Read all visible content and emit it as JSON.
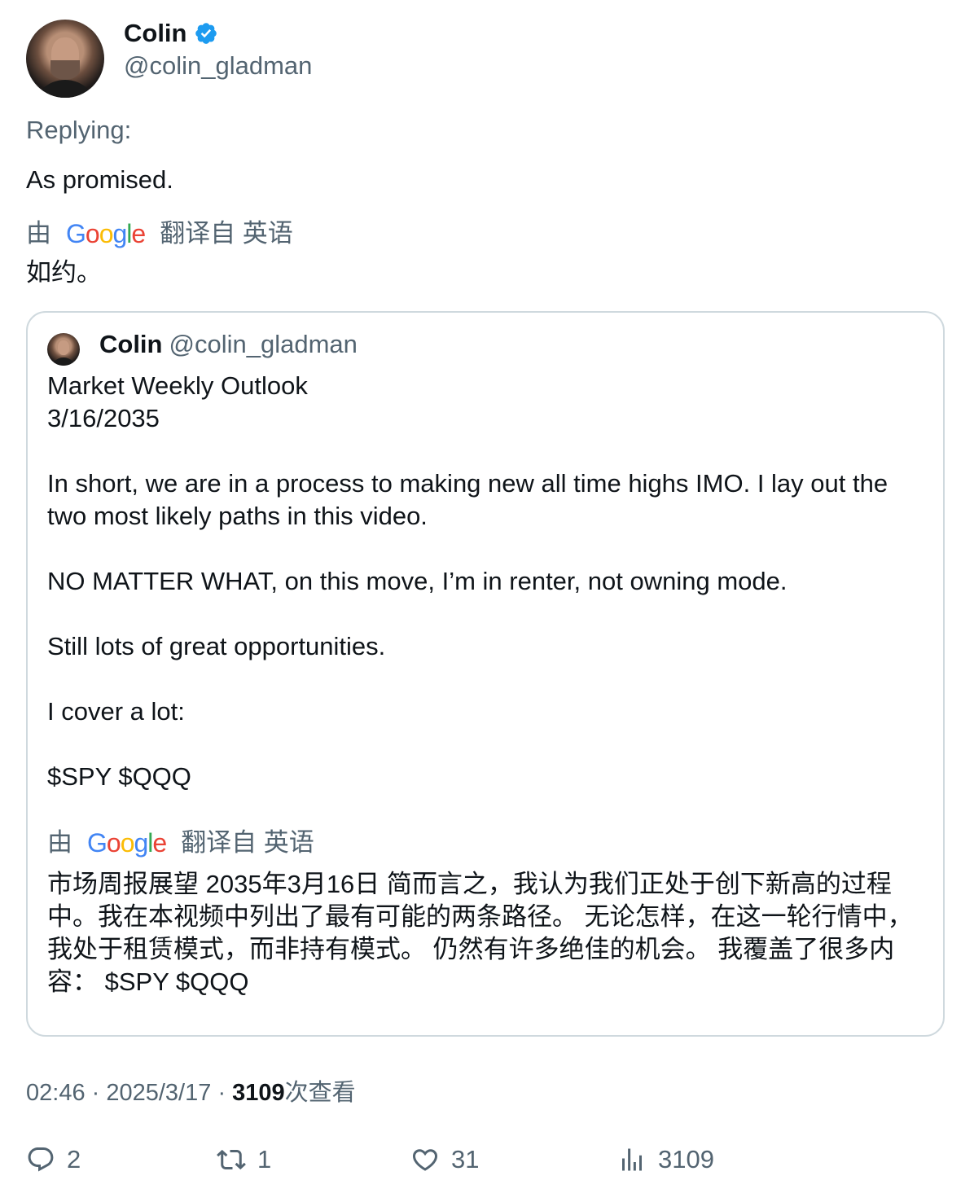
{
  "author": {
    "name": "Colin",
    "handle": "@colin_gladman"
  },
  "replying_label": "Replying:",
  "tweet_text": "As promised.",
  "translation": {
    "by": "由",
    "logo": "Google",
    "from": "翻译自 英语",
    "text": "如约。"
  },
  "quote": {
    "name": "Colin",
    "handle": "@colin_gladman",
    "lines": [
      "Market Weekly Outlook",
      "3/16/2035",
      "In short, we are in a process to making new all time highs IMO. I lay out the two most likely paths in this video.",
      "NO MATTER WHAT, on this move, I’m in renter, not owning mode.",
      "Still lots of great opportunities.",
      "I cover a lot:",
      "$SPY $QQQ"
    ],
    "translation": {
      "by": "由",
      "logo": "Google",
      "from": "翻译自 英语",
      "text": "市场周报展望 2035年3月16日 简而言之，我认为我们正处于创下新高的过程中。我在本视频中列出了最有可能的两条路径。 无论怎样，在这一轮行情中，我处于租赁模式，而非持有模式。 仍然有许多绝佳的机会。 我覆盖了很多内容： $SPY $QQQ"
    }
  },
  "meta": {
    "time": "02:46",
    "date": "2025/3/17",
    "views": "3109",
    "views_label": "次查看"
  },
  "actions": {
    "replies": "2",
    "retweets": "1",
    "likes": "31",
    "views": "3109"
  },
  "colors": {
    "accent": "#1d9bf0",
    "secondary_text": "#536471"
  },
  "icons": [
    "verified-badge-icon",
    "reply-icon",
    "retweet-icon",
    "like-icon",
    "views-icon"
  ]
}
